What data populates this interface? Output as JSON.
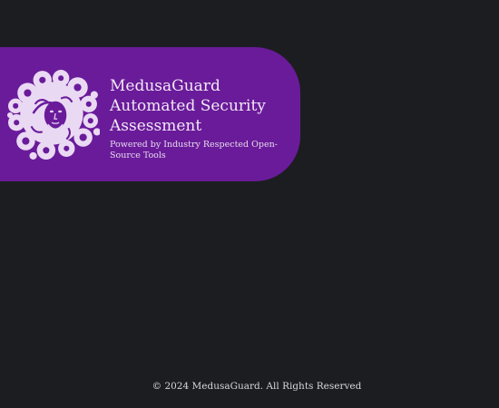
{
  "hero": {
    "logo_icon": "medusa-head-icon",
    "title": "MedusaGuard Automated Security Assessment",
    "subtitle": "Powered by Industry Respected Open-Source Tools"
  },
  "footer": {
    "copyright": "© 2024 MedusaGuard. All Rights Reserved"
  },
  "colors": {
    "background": "#1c1d21",
    "banner": "#6a1b9a",
    "logo": "#ead9f3"
  }
}
